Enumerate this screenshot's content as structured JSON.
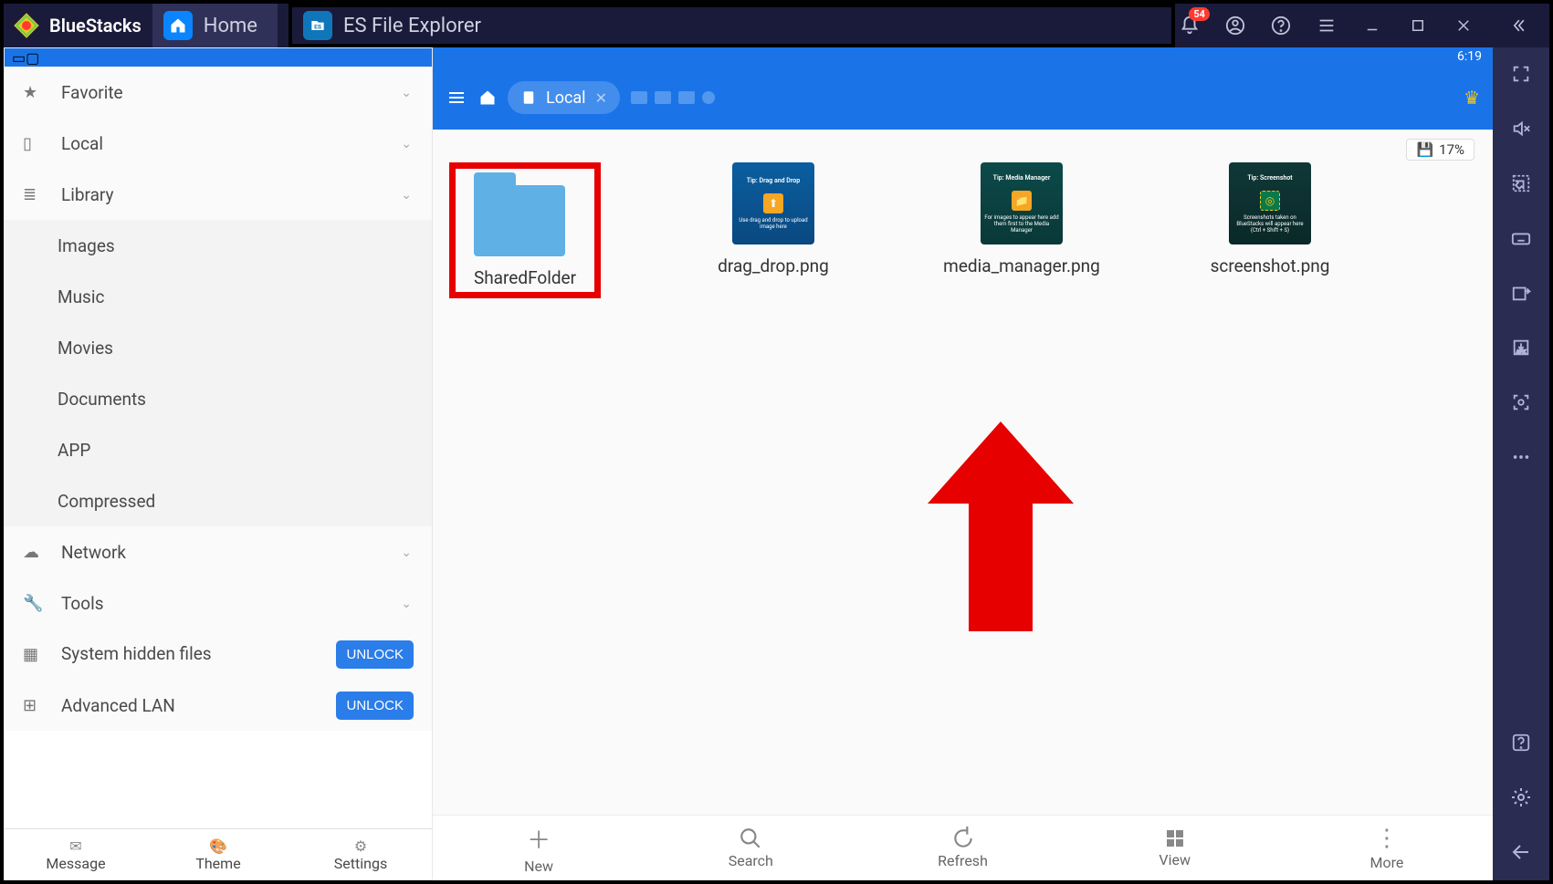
{
  "titlebar": {
    "brand": "BlueStacks",
    "tabs": [
      {
        "label": "Home"
      },
      {
        "label": "ES File Explorer"
      }
    ],
    "notification_count": "54"
  },
  "status": {
    "clock": "6:19"
  },
  "sidebar": {
    "items": [
      {
        "label": "Favorite",
        "kind": "cat"
      },
      {
        "label": "Local",
        "kind": "cat"
      },
      {
        "label": "Library",
        "kind": "cat"
      },
      {
        "label": "Images",
        "kind": "sub"
      },
      {
        "label": "Music",
        "kind": "sub"
      },
      {
        "label": "Movies",
        "kind": "sub"
      },
      {
        "label": "Documents",
        "kind": "sub"
      },
      {
        "label": "APP",
        "kind": "sub"
      },
      {
        "label": "Compressed",
        "kind": "sub"
      },
      {
        "label": "Network",
        "kind": "cat"
      },
      {
        "label": "Tools",
        "kind": "cat"
      },
      {
        "label": "System hidden files",
        "kind": "unlock",
        "btn": "UNLOCK"
      },
      {
        "label": "Advanced LAN",
        "kind": "unlock",
        "btn": "UNLOCK"
      }
    ],
    "bottom": [
      {
        "label": "Message"
      },
      {
        "label": "Theme"
      },
      {
        "label": "Settings"
      }
    ]
  },
  "pathbar": {
    "crumb": "Local"
  },
  "analyze_pill": "17%",
  "files": {
    "items": [
      {
        "label": "SharedFolder",
        "type": "folder",
        "highlight": true
      },
      {
        "label": "drag_drop.png",
        "type": "thumb1",
        "tip": "Tip: Drag and Drop",
        "desc": "Use drag and drop to upload image here"
      },
      {
        "label": "media_manager.png",
        "type": "thumb2",
        "tip": "Tip: Media Manager",
        "desc": "For images to appear here add them first to the Media Manager"
      },
      {
        "label": "screenshot.png",
        "type": "thumb3",
        "tip": "Tip: Screenshot",
        "desc": "Screenshots taken on BlueStacks will appear here (Ctrl + Shift + S)"
      }
    ]
  },
  "actionbar": {
    "items": [
      {
        "label": "New"
      },
      {
        "label": "Search"
      },
      {
        "label": "Refresh"
      },
      {
        "label": "View"
      },
      {
        "label": "More"
      }
    ]
  }
}
